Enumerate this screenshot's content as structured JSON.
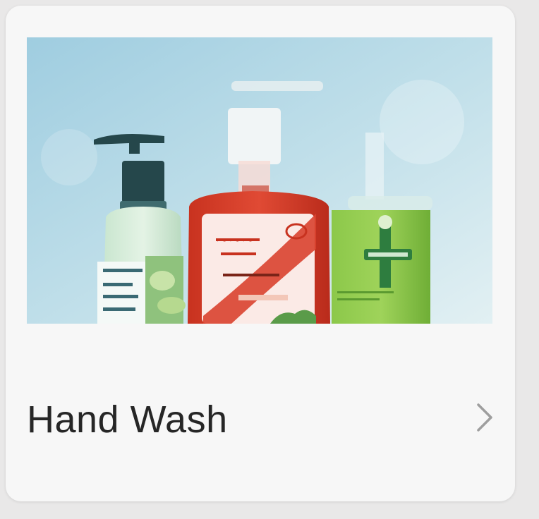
{
  "category_card": {
    "title": "Hand Wash",
    "chevron_icon": "chevron-right-icon",
    "image": {
      "subject": "hand-wash-bottles",
      "colors": {
        "sky_top": "#a9d3e3",
        "sky_bottom": "#dcecef",
        "red_bottle": "#d9432f",
        "green_bottle": "#7fbf3f",
        "pump_dark": "#25474b"
      }
    }
  }
}
